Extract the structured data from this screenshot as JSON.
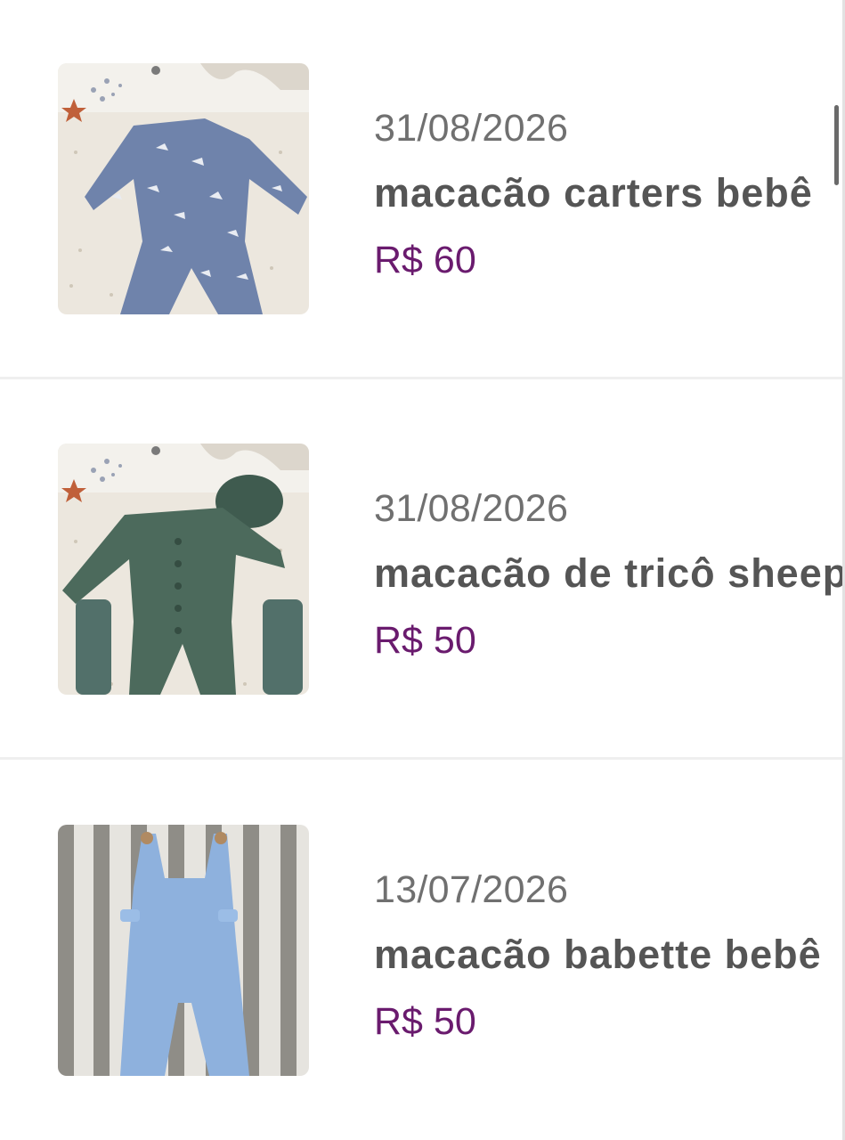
{
  "listings": [
    {
      "date": "31/08/2026",
      "title": "macacão carters bebê",
      "price": "R$ 60",
      "image_icon": "blue-romper-photo"
    },
    {
      "date": "31/08/2026",
      "title": "macacão de tricô sheep",
      "price": "R$ 50",
      "image_icon": "green-knit-romper-photo"
    },
    {
      "date": "13/07/2026",
      "title": "macacão babette bebê",
      "price": "R$ 50",
      "image_icon": "light-blue-overalls-photo"
    }
  ],
  "colors": {
    "date": "#707070",
    "title": "#555555",
    "price": "#6a1b6e",
    "divider": "#efefef"
  }
}
